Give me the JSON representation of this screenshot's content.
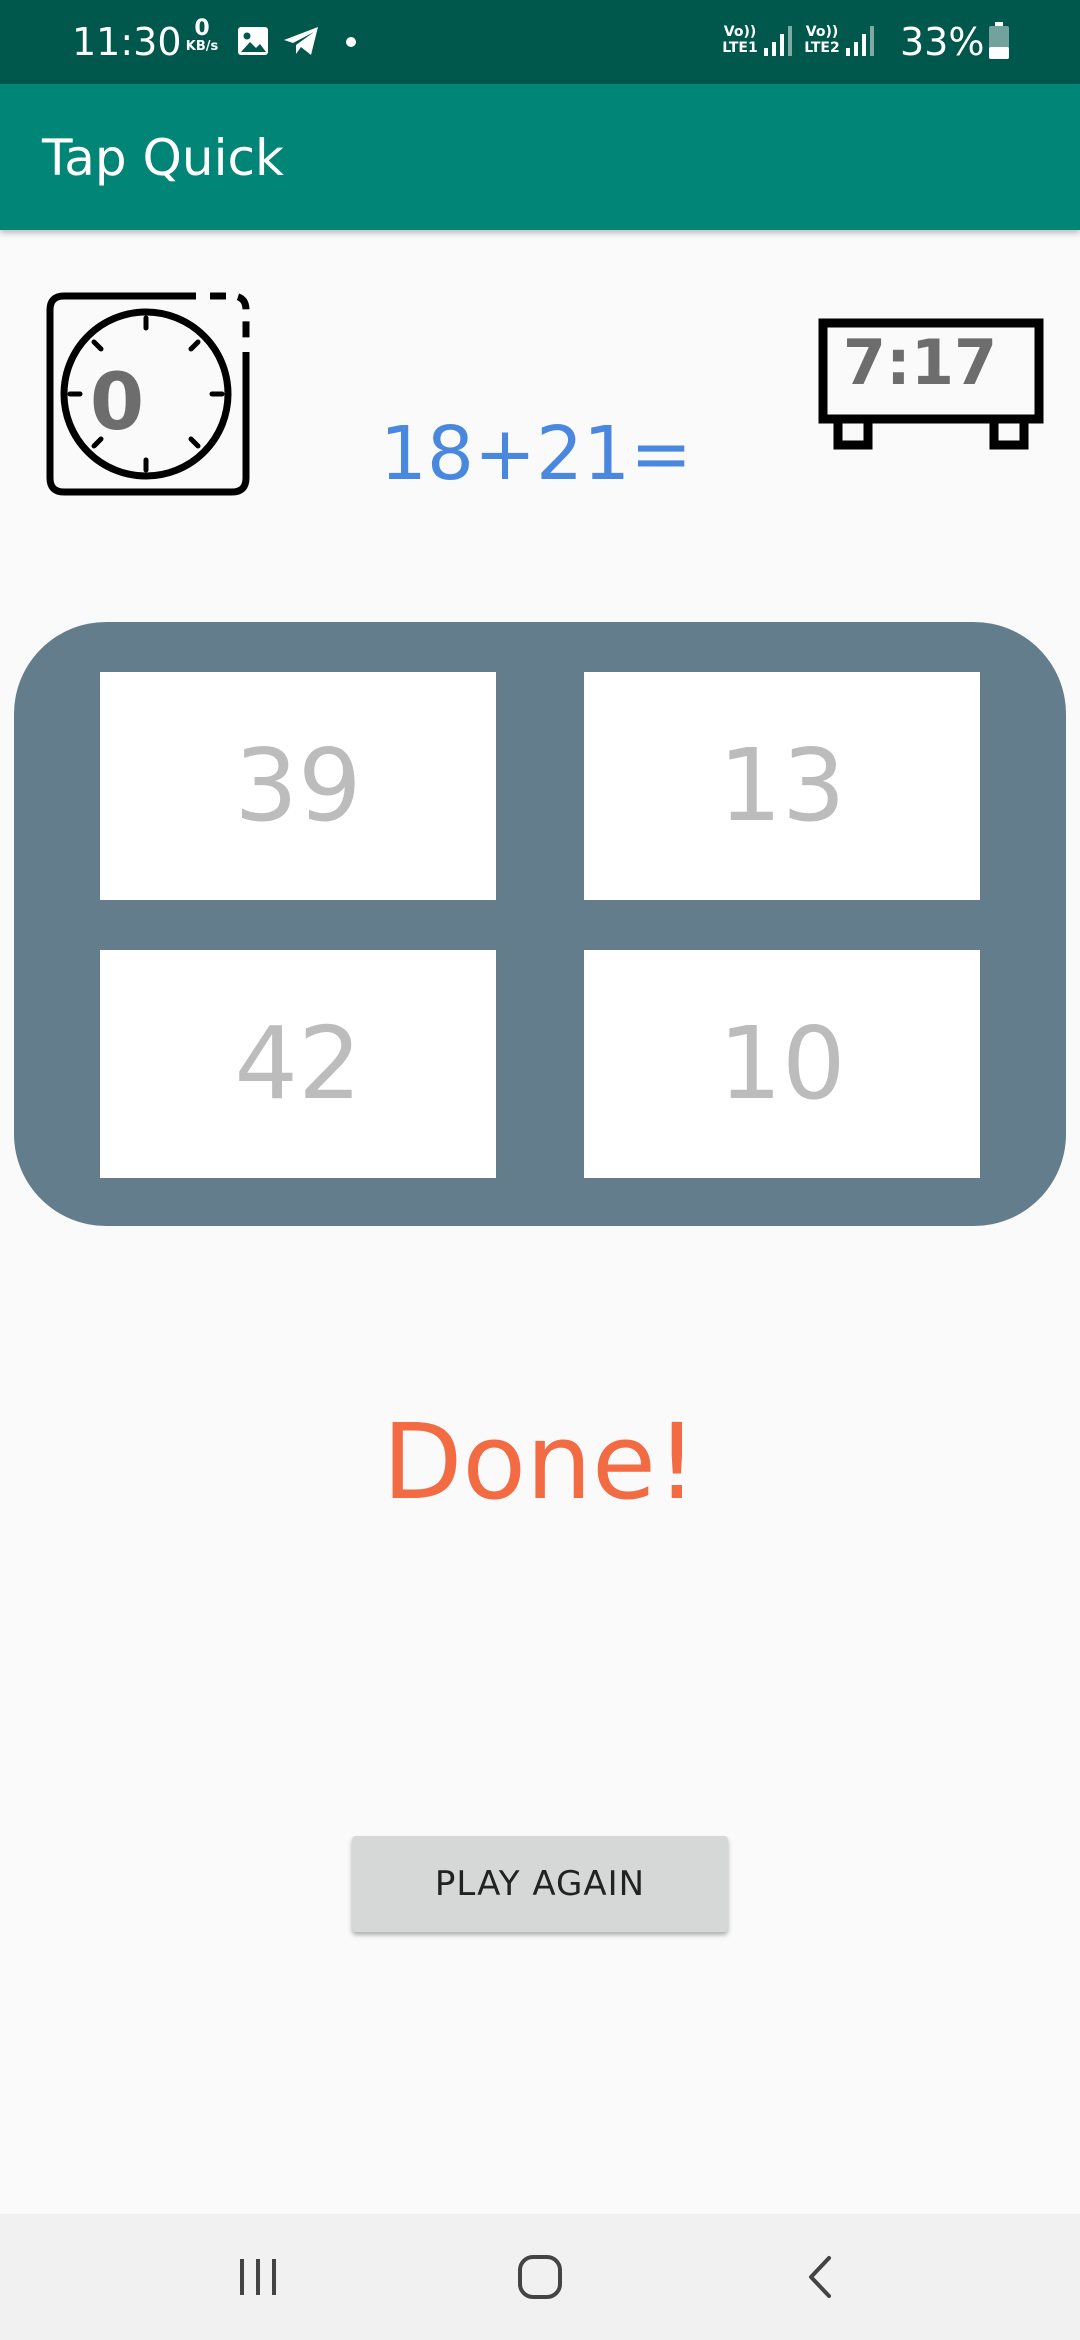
{
  "status_bar": {
    "time": "11:30",
    "net_speed_value": "0",
    "net_speed_unit": "KB/s",
    "sim1_label_top": "Vo))",
    "sim1_label_bottom": "LTE1",
    "sim2_label_top": "Vo))",
    "sim2_label_bottom": "LTE2",
    "battery_percent": "33%",
    "icons": [
      "gallery-icon",
      "telegram-icon",
      "notification-dot-icon",
      "signal-icon",
      "signal-icon",
      "battery-icon"
    ]
  },
  "app_bar": {
    "title": "Tap Quick"
  },
  "game": {
    "score": "0",
    "timer": "7:17",
    "question": "18+21=",
    "answers": [
      "39",
      "13",
      "42",
      "10"
    ],
    "result": "Done!",
    "play_again_label": "PLAY AGAIN"
  },
  "nav_bar": {
    "buttons": [
      "recent-apps-icon",
      "home-icon",
      "back-icon"
    ]
  },
  "colors": {
    "status_bar": "#00574b",
    "app_bar": "#008577",
    "board": "#637d8c",
    "question": "#4a88e0",
    "result": "#f26b43",
    "answer_text": "#bcbcbc",
    "button_bg": "#d6d7d7"
  }
}
